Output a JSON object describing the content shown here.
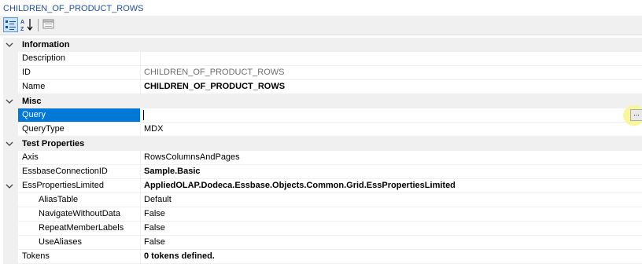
{
  "title": "CHILDREN_OF_PRODUCT_ROWS",
  "toolbar": {
    "buttons": [
      {
        "icon": "categorized-icon",
        "active": true
      },
      {
        "icon": "alphabetical-sort-icon",
        "active": false
      },
      {
        "icon": "property-pages-icon",
        "active": false
      }
    ]
  },
  "categories": {
    "information": "Information",
    "misc": "Misc",
    "test_properties": "Test Properties"
  },
  "properties": {
    "description": {
      "name": "Description",
      "value": ""
    },
    "id": {
      "name": "ID",
      "value": "CHILDREN_OF_PRODUCT_ROWS"
    },
    "name": {
      "name": "Name",
      "value": "CHILDREN_OF_PRODUCT_ROWS"
    },
    "query": {
      "name": "Query",
      "value": "",
      "button": "..."
    },
    "query_type": {
      "name": "QueryType",
      "value": "MDX"
    },
    "axis": {
      "name": "Axis",
      "value": "RowsColumnsAndPages"
    },
    "essbase_connection_id": {
      "name": "EssbaseConnectionID",
      "value": "Sample.Basic"
    },
    "ess_properties_limited": {
      "name": "EssPropertiesLimited",
      "value": "AppliedOLAP.Dodeca.Essbase.Objects.Common.Grid.EssPropertiesLimited"
    },
    "alias_table": {
      "name": "AliasTable",
      "value": "Default"
    },
    "navigate_without_data": {
      "name": "NavigateWithoutData",
      "value": "False"
    },
    "repeat_member_labels": {
      "name": "RepeatMemberLabels",
      "value": "False"
    },
    "use_aliases": {
      "name": "UseAliases",
      "value": "False"
    },
    "tokens": {
      "name": "Tokens",
      "value": "0 tokens defined."
    }
  },
  "colors": {
    "selection": "#0078d7",
    "title": "#1f4e9e",
    "highlight": "#fbf58a"
  }
}
